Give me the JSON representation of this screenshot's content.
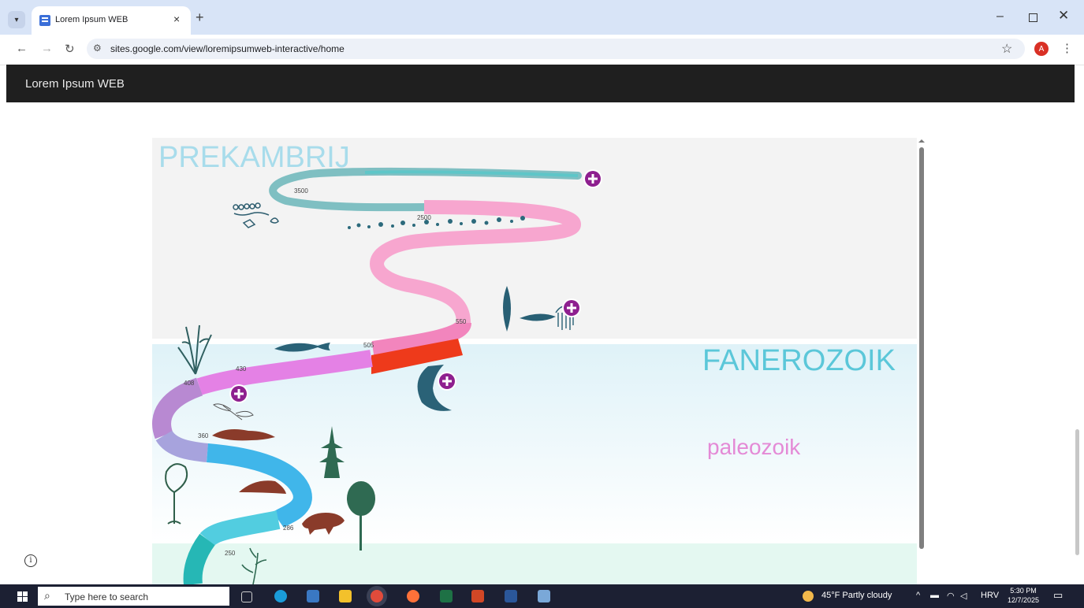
{
  "browser": {
    "tab_title": "Lorem Ipsum WEB",
    "tab_close": "×",
    "new_tab": "+",
    "url": "sites.google.com/view/loremipsumweb-interactive/home",
    "profile_initial": "A"
  },
  "site": {
    "title": "Lorem Ipsum WEB"
  },
  "infographic": {
    "eras": {
      "precambrian": "PREKAMBRIJ",
      "phanerozoic": "FANEROZOIK",
      "paleozoic": "paleozoik"
    },
    "timeline_labels": [
      "3500",
      "2500",
      "550",
      "505",
      "430",
      "408",
      "360",
      "286",
      "250"
    ],
    "colors": {
      "precambrian_text": "#a8dceb",
      "phanerozoic_text": "#5bc7d9",
      "paleozoic_text": "#e48ad6",
      "hotspot": "#8e1f8f"
    }
  },
  "taskbar": {
    "search_placeholder": "Type here to search",
    "weather": "45°F  Partly cloudy",
    "language": "HRV",
    "time": "5:30 PM",
    "date": "12/7/2025"
  }
}
